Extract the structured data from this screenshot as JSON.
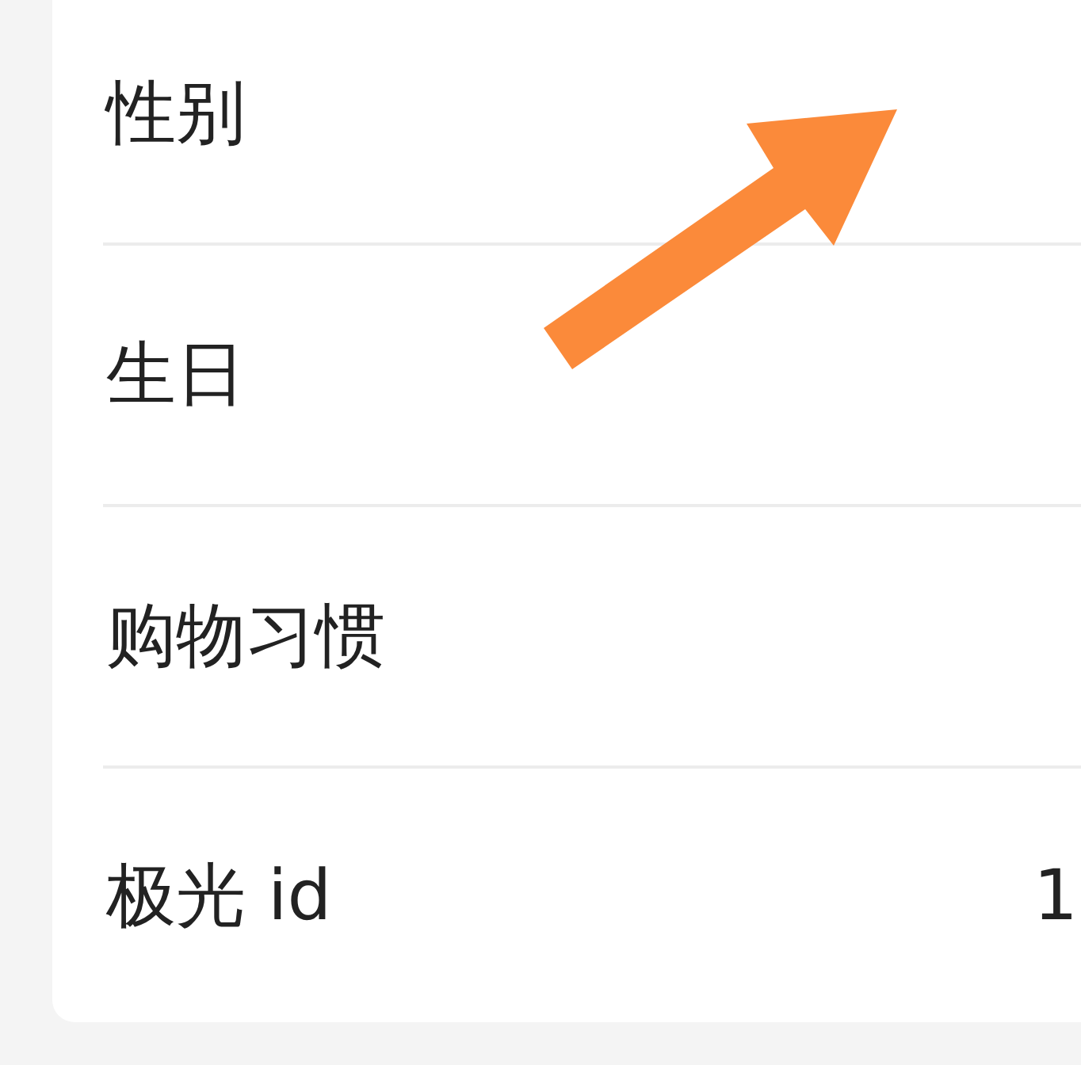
{
  "rows": [
    {
      "label": "性别"
    },
    {
      "label": "生日"
    },
    {
      "label": "购物习惯"
    },
    {
      "label": "极光 id",
      "value": "1"
    }
  ],
  "overlay": {
    "kind": "arrow"
  }
}
